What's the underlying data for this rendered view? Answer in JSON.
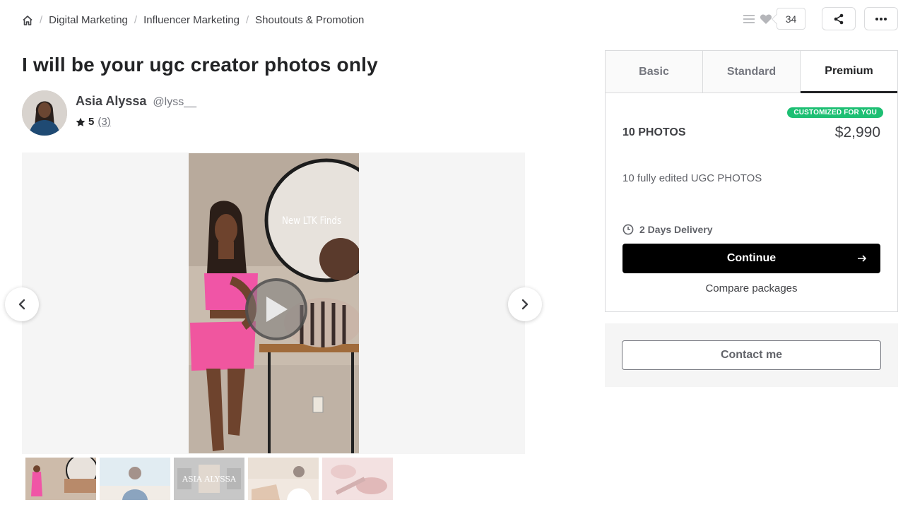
{
  "breadcrumb": {
    "home_icon": "home-icon",
    "items": [
      "Digital Marketing",
      "Influencer Marketing",
      "Shoutouts & Promotion"
    ]
  },
  "actions": {
    "like_count": "34"
  },
  "gig": {
    "title": "I will be your ugc creator photos only"
  },
  "seller": {
    "name": "Asia Alyssa",
    "handle": "@lyss__",
    "rating": "5",
    "reviews": "(3)"
  },
  "gallery": {
    "overlay_text": "New LTK Finds",
    "thumb_text": "ASIA ALYSSA"
  },
  "package": {
    "tabs": [
      "Basic",
      "Standard",
      "Premium"
    ],
    "active_tab": "Premium",
    "badge": "CUSTOMIZED FOR YOU",
    "title": "10 PHOTOS",
    "price": "$2,990",
    "description": "10 fully edited UGC PHOTOS",
    "delivery": "2 Days Delivery",
    "continue_label": "Continue",
    "compare_label": "Compare packages"
  },
  "contact": {
    "label": "Contact me"
  },
  "colors": {
    "accent_green": "#1dbf73",
    "primary_button": "#000000"
  }
}
